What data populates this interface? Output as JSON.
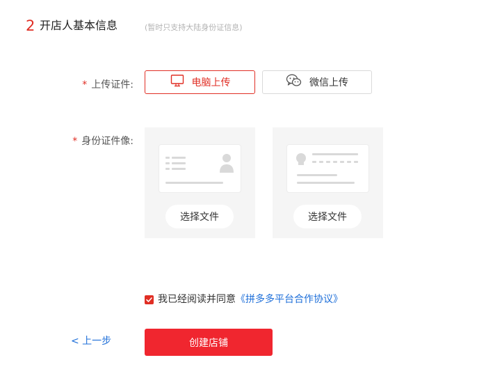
{
  "section": {
    "number": "2",
    "title": "开店人基本信息",
    "note": "(暂时只支持大陆身份证信息)"
  },
  "upload": {
    "label": "上传证件:",
    "required_mark": "*",
    "options": [
      {
        "label": "电脑上传",
        "icon": "monitor-icon",
        "active": true
      },
      {
        "label": "微信上传",
        "icon": "wechat-icon",
        "active": false
      }
    ]
  },
  "id_photos": {
    "label": "身份证件像:",
    "required_mark": "*",
    "front_button": "选择文件",
    "back_button": "选择文件"
  },
  "agreement": {
    "checked": true,
    "text": "我已经阅读并同意",
    "link": "《拼多多平台合作协议》"
  },
  "actions": {
    "prev": "< 上一步",
    "create": "创建店铺"
  },
  "colors": {
    "accent": "#e02e24",
    "button": "#f0262f",
    "link": "#1e6fd9",
    "placeholder_bg": "#f5f5f5"
  }
}
